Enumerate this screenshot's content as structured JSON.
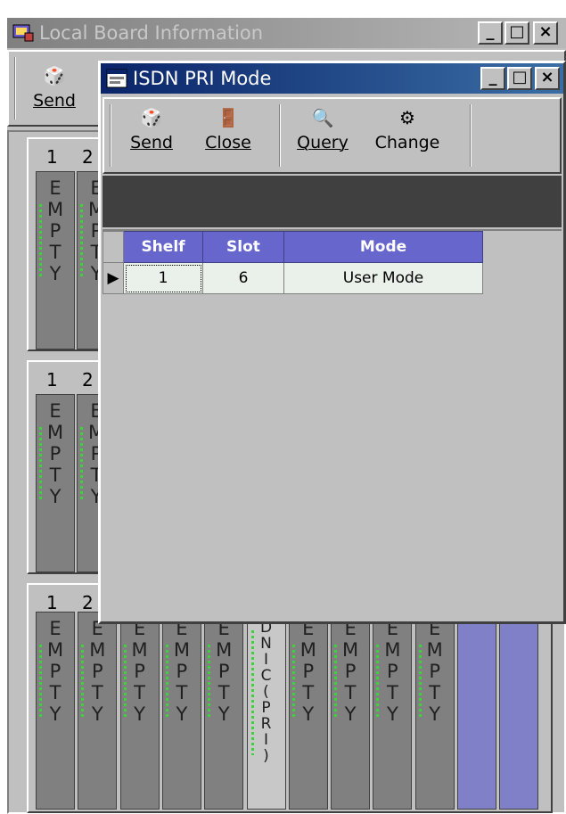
{
  "main_window": {
    "title": "Local Board Information",
    "toolbar": {
      "send_label": "Send"
    },
    "shelves": [
      {
        "slot_numbers": [
          "1",
          "2"
        ],
        "slots": [
          "EMPTY",
          "EMPTY"
        ]
      },
      {
        "slot_numbers": [
          "1",
          "2"
        ],
        "slots": [
          "EMPTY",
          "EMPTY"
        ]
      },
      {
        "slot_numbers": [
          "1",
          "2"
        ],
        "slots": [
          "EMPTY",
          "EMPTY",
          "EMPTY",
          "EMPTY",
          "EMPTY",
          "DNIC(PRI)",
          "EMPTY",
          "EMPTY",
          "EMPTY",
          "EMPTY",
          "",
          ""
        ]
      }
    ]
  },
  "dialog": {
    "title": "ISDN PRI Mode",
    "toolbar": {
      "send_label": "Send",
      "close_label": "Close",
      "query_label": "Query",
      "change_label": "Change"
    },
    "table": {
      "columns": [
        "Shelf",
        "Slot",
        "Mode"
      ],
      "rows": [
        {
          "shelf": "1",
          "slot": "6",
          "mode": "User Mode"
        }
      ]
    }
  },
  "colors": {
    "active_title": "#0a246a",
    "header": "#6666cc",
    "led": "#3cd23c",
    "slot_empty": "#808080",
    "slot_unused": "#8080c8"
  }
}
